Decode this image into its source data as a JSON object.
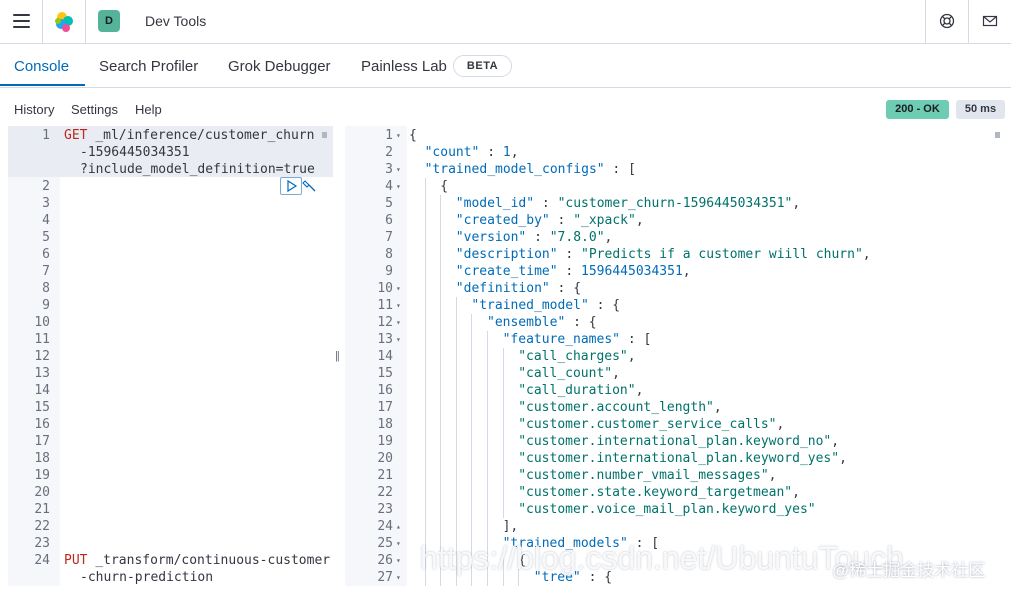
{
  "header": {
    "title": "Dev Tools",
    "space_initial": "D",
    "menu_icon": "hamburger-icon",
    "help_icon": "help-icon",
    "mail_icon": "mail-icon"
  },
  "tabs": [
    {
      "label": "Console",
      "active": true
    },
    {
      "label": "Search Profiler",
      "active": false
    },
    {
      "label": "Grok Debugger",
      "active": false
    },
    {
      "label": "Painless Lab",
      "active": false
    }
  ],
  "beta_badge": "BETA",
  "subnav": {
    "history": "History",
    "settings": "Settings",
    "help": "Help"
  },
  "status": {
    "code": "200 - OK",
    "time": "50 ms"
  },
  "request_lines": [
    {
      "n": "1",
      "method": "GET",
      "text": "_ml/inference/customer_churn"
    },
    {
      "n": "",
      "method": "",
      "text": "-1596445034351"
    },
    {
      "n": "",
      "method": "",
      "text": "?include_model_definition=true"
    },
    {
      "n": "2",
      "method": "",
      "text": ""
    },
    {
      "n": "3",
      "method": "",
      "text": ""
    },
    {
      "n": "4",
      "method": "",
      "text": ""
    },
    {
      "n": "5",
      "method": "",
      "text": ""
    },
    {
      "n": "6",
      "method": "",
      "text": ""
    },
    {
      "n": "7",
      "method": "",
      "text": ""
    },
    {
      "n": "8",
      "method": "",
      "text": ""
    },
    {
      "n": "9",
      "method": "",
      "text": ""
    },
    {
      "n": "10",
      "method": "",
      "text": ""
    },
    {
      "n": "11",
      "method": "",
      "text": ""
    },
    {
      "n": "12",
      "method": "",
      "text": ""
    },
    {
      "n": "13",
      "method": "",
      "text": ""
    },
    {
      "n": "14",
      "method": "",
      "text": ""
    },
    {
      "n": "15",
      "method": "",
      "text": ""
    },
    {
      "n": "16",
      "method": "",
      "text": ""
    },
    {
      "n": "17",
      "method": "",
      "text": ""
    },
    {
      "n": "18",
      "method": "",
      "text": ""
    },
    {
      "n": "19",
      "method": "",
      "text": ""
    },
    {
      "n": "20",
      "method": "",
      "text": ""
    },
    {
      "n": "21",
      "method": "",
      "text": ""
    },
    {
      "n": "22",
      "method": "",
      "text": ""
    },
    {
      "n": "23",
      "method": "",
      "text": ""
    },
    {
      "n": "24",
      "method": "PUT",
      "text": "_transform/continuous-customer"
    },
    {
      "n": "",
      "method": "",
      "text": "-churn-prediction"
    }
  ],
  "response_lines": [
    {
      "n": "1",
      "fold": "▾",
      "indent": 0,
      "parts": [
        [
          "punc",
          "{"
        ]
      ]
    },
    {
      "n": "2",
      "fold": "",
      "indent": 1,
      "parts": [
        [
          "key",
          "\"count\""
        ],
        [
          "punc",
          " : "
        ],
        [
          "num",
          "1"
        ],
        [
          "punc",
          ","
        ]
      ]
    },
    {
      "n": "3",
      "fold": "▾",
      "indent": 1,
      "parts": [
        [
          "key",
          "\"trained_model_configs\""
        ],
        [
          "punc",
          " : ["
        ]
      ]
    },
    {
      "n": "4",
      "fold": "▾",
      "indent": 2,
      "parts": [
        [
          "punc",
          "{"
        ]
      ]
    },
    {
      "n": "5",
      "fold": "",
      "indent": 3,
      "parts": [
        [
          "key",
          "\"model_id\""
        ],
        [
          "punc",
          " : "
        ],
        [
          "val",
          "\"customer_churn-1596445034351\""
        ],
        [
          "punc",
          ","
        ]
      ]
    },
    {
      "n": "6",
      "fold": "",
      "indent": 3,
      "parts": [
        [
          "key",
          "\"created_by\""
        ],
        [
          "punc",
          " : "
        ],
        [
          "val",
          "\"_xpack\""
        ],
        [
          "punc",
          ","
        ]
      ]
    },
    {
      "n": "7",
      "fold": "",
      "indent": 3,
      "parts": [
        [
          "key",
          "\"version\""
        ],
        [
          "punc",
          " : "
        ],
        [
          "val",
          "\"7.8.0\""
        ],
        [
          "punc",
          ","
        ]
      ]
    },
    {
      "n": "8",
      "fold": "",
      "indent": 3,
      "parts": [
        [
          "key",
          "\"description\""
        ],
        [
          "punc",
          " : "
        ],
        [
          "val",
          "\"Predicts if a customer wiill churn\""
        ],
        [
          "punc",
          ","
        ]
      ]
    },
    {
      "n": "9",
      "fold": "",
      "indent": 3,
      "parts": [
        [
          "key",
          "\"create_time\""
        ],
        [
          "punc",
          " : "
        ],
        [
          "num",
          "1596445034351"
        ],
        [
          "punc",
          ","
        ]
      ]
    },
    {
      "n": "10",
      "fold": "▾",
      "indent": 3,
      "parts": [
        [
          "key",
          "\"definition\""
        ],
        [
          "punc",
          " : {"
        ]
      ]
    },
    {
      "n": "11",
      "fold": "▾",
      "indent": 4,
      "parts": [
        [
          "key",
          "\"trained_model\""
        ],
        [
          "punc",
          " : {"
        ]
      ]
    },
    {
      "n": "12",
      "fold": "▾",
      "indent": 5,
      "parts": [
        [
          "key",
          "\"ensemble\""
        ],
        [
          "punc",
          " : {"
        ]
      ]
    },
    {
      "n": "13",
      "fold": "▾",
      "indent": 6,
      "parts": [
        [
          "key",
          "\"feature_names\""
        ],
        [
          "punc",
          " : ["
        ]
      ]
    },
    {
      "n": "14",
      "fold": "",
      "indent": 7,
      "parts": [
        [
          "val",
          "\"call_charges\""
        ],
        [
          "punc",
          ","
        ]
      ]
    },
    {
      "n": "15",
      "fold": "",
      "indent": 7,
      "parts": [
        [
          "val",
          "\"call_count\""
        ],
        [
          "punc",
          ","
        ]
      ]
    },
    {
      "n": "16",
      "fold": "",
      "indent": 7,
      "parts": [
        [
          "val",
          "\"call_duration\""
        ],
        [
          "punc",
          ","
        ]
      ]
    },
    {
      "n": "17",
      "fold": "",
      "indent": 7,
      "parts": [
        [
          "val",
          "\"customer.account_length\""
        ],
        [
          "punc",
          ","
        ]
      ]
    },
    {
      "n": "18",
      "fold": "",
      "indent": 7,
      "parts": [
        [
          "val",
          "\"customer.customer_service_calls\""
        ],
        [
          "punc",
          ","
        ]
      ]
    },
    {
      "n": "19",
      "fold": "",
      "indent": 7,
      "parts": [
        [
          "val",
          "\"customer.international_plan.keyword_no\""
        ],
        [
          "punc",
          ","
        ]
      ]
    },
    {
      "n": "20",
      "fold": "",
      "indent": 7,
      "parts": [
        [
          "val",
          "\"customer.international_plan.keyword_yes\""
        ],
        [
          "punc",
          ","
        ]
      ]
    },
    {
      "n": "21",
      "fold": "",
      "indent": 7,
      "parts": [
        [
          "val",
          "\"customer.number_vmail_messages\""
        ],
        [
          "punc",
          ","
        ]
      ]
    },
    {
      "n": "22",
      "fold": "",
      "indent": 7,
      "parts": [
        [
          "val",
          "\"customer.state.keyword_targetmean\""
        ],
        [
          "punc",
          ","
        ]
      ]
    },
    {
      "n": "23",
      "fold": "",
      "indent": 7,
      "parts": [
        [
          "val",
          "\"customer.voice_mail_plan.keyword_yes\""
        ]
      ]
    },
    {
      "n": "24",
      "fold": "▴",
      "indent": 6,
      "parts": [
        [
          "punc",
          "],"
        ]
      ]
    },
    {
      "n": "25",
      "fold": "▾",
      "indent": 6,
      "parts": [
        [
          "key",
          "\"trained_models\""
        ],
        [
          "punc",
          " : ["
        ]
      ]
    },
    {
      "n": "26",
      "fold": "▾",
      "indent": 7,
      "parts": [
        [
          "punc",
          "{"
        ]
      ]
    },
    {
      "n": "27",
      "fold": "▾",
      "indent": 8,
      "parts": [
        [
          "key",
          "\"tree\""
        ],
        [
          "punc",
          " : {"
        ]
      ]
    }
  ],
  "watermark": "https://blog.csdn.net/UbuntuTouch",
  "watermark_cn": "@稀土掘金技术社区",
  "colors": {
    "accent": "#006bb8",
    "ok": "#6dccb1",
    "method": "#bd271e",
    "string": "#00726b"
  }
}
